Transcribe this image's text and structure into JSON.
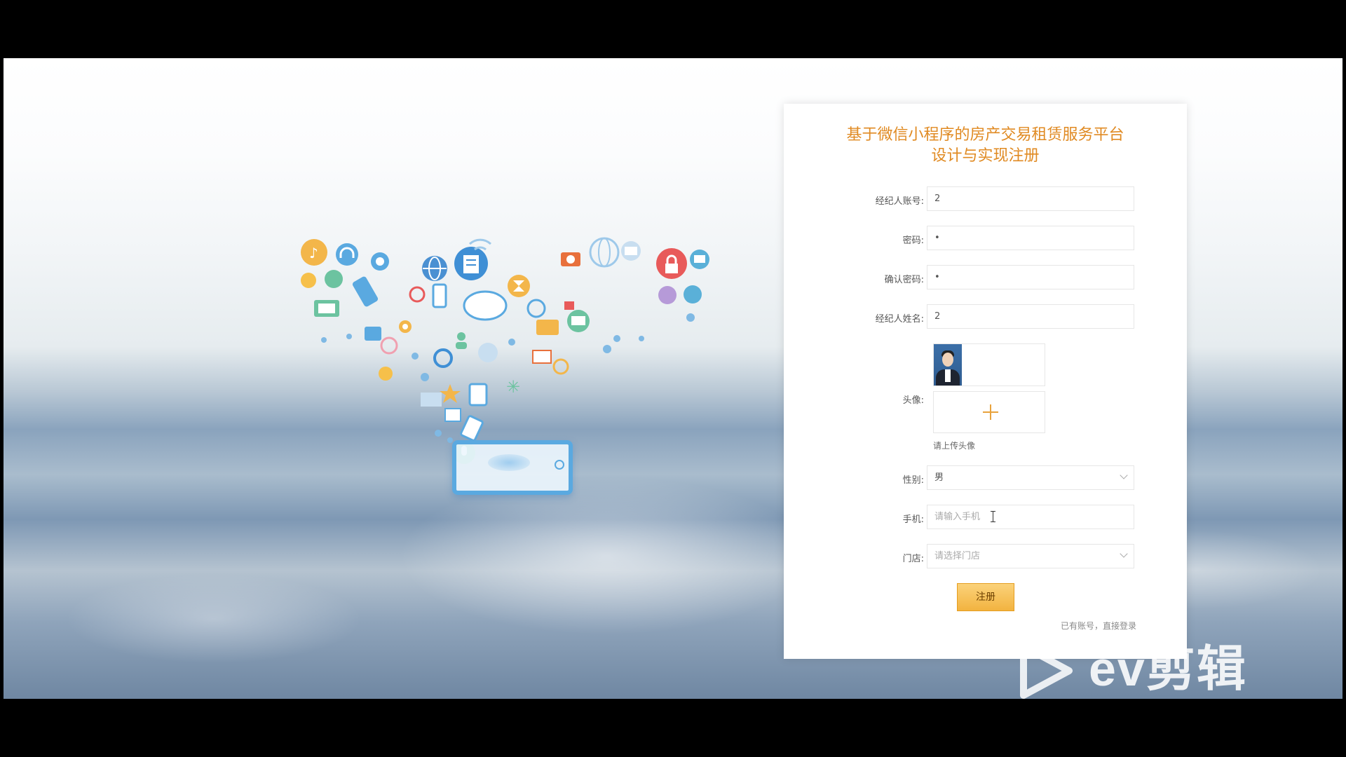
{
  "form": {
    "title_line1": "基于微信小程序的房产交易租赁服务平台",
    "title_line2": "设计与实现注册",
    "account_label": "经纪人账号:",
    "account_value": "2",
    "password_label": "密码:",
    "password_value": "•",
    "confirm_label": "确认密码:",
    "confirm_value": "•",
    "name_label": "经纪人姓名:",
    "name_value": "2",
    "avatar_label": "头像:",
    "avatar_hint": "请上传头像",
    "gender_label": "性别:",
    "gender_value": "男",
    "phone_label": "手机:",
    "phone_placeholder": "请输入手机",
    "store_label": "门店:",
    "store_placeholder": "请选择门店",
    "submit_label": "注册",
    "login_link": "已有账号，直接登录"
  },
  "watermark": {
    "text": "ev剪辑"
  },
  "colors": {
    "accent": "#e08a22",
    "button": "#f2b340"
  }
}
